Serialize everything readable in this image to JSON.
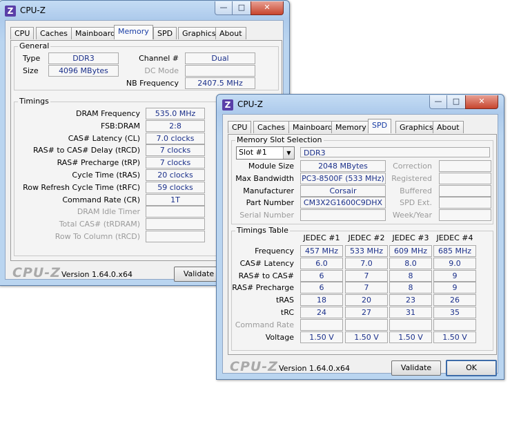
{
  "win1": {
    "title": "CPU-Z",
    "tabs": [
      "CPU",
      "Caches",
      "Mainboard",
      "Memory",
      "SPD",
      "Graphics",
      "About"
    ],
    "active_tab": "Memory",
    "general": {
      "title": "General",
      "type_label": "Type",
      "type_value": "DDR3",
      "size_label": "Size",
      "size_value": "4096 MBytes",
      "channel_label": "Channel #",
      "channel_value": "Dual",
      "dc_mode_label": "DC Mode",
      "dc_mode_value": "",
      "nb_freq_label": "NB Frequency",
      "nb_freq_value": "2407.5 MHz"
    },
    "timings": {
      "title": "Timings",
      "rows": [
        {
          "label": "DRAM Frequency",
          "value": "535.0 MHz",
          "disabled": false
        },
        {
          "label": "FSB:DRAM",
          "value": "2:8",
          "disabled": false
        },
        {
          "label": "CAS# Latency (CL)",
          "value": "7.0 clocks",
          "disabled": false
        },
        {
          "label": "RAS# to CAS# Delay (tRCD)",
          "value": "7 clocks",
          "disabled": false
        },
        {
          "label": "RAS# Precharge (tRP)",
          "value": "7 clocks",
          "disabled": false
        },
        {
          "label": "Cycle Time (tRAS)",
          "value": "20 clocks",
          "disabled": false
        },
        {
          "label": "Row Refresh Cycle Time (tRFC)",
          "value": "59 clocks",
          "disabled": false
        },
        {
          "label": "Command Rate (CR)",
          "value": "1T",
          "disabled": false
        },
        {
          "label": "DRAM Idle Timer",
          "value": "",
          "disabled": true
        },
        {
          "label": "Total CAS# (tRDRAM)",
          "value": "",
          "disabled": true
        },
        {
          "label": "Row To Column (tRCD)",
          "value": "",
          "disabled": true
        }
      ]
    },
    "logo": "CPU-Z",
    "version": "Version 1.64.0.x64",
    "validate_label": "Validate"
  },
  "win2": {
    "title": "CPU-Z",
    "tabs": [
      "CPU",
      "Caches",
      "Mainboard",
      "Memory",
      "SPD",
      "Graphics",
      "About"
    ],
    "active_tab": "SPD",
    "slot": {
      "title": "Memory Slot Selection",
      "selected": "Slot #1",
      "type_value": "DDR3",
      "left_rows": [
        {
          "label": "Module Size",
          "value": "2048 MBytes"
        },
        {
          "label": "Max Bandwidth",
          "value": "PC3-8500F (533 MHz)"
        },
        {
          "label": "Manufacturer",
          "value": "Corsair"
        },
        {
          "label": "Part Number",
          "value": "CM3X2G1600C9DHX"
        },
        {
          "label": "Serial Number",
          "value": ""
        }
      ],
      "right_rows": [
        {
          "label": "Correction",
          "value": ""
        },
        {
          "label": "Registered",
          "value": ""
        },
        {
          "label": "Buffered",
          "value": ""
        },
        {
          "label": "SPD Ext.",
          "value": ""
        },
        {
          "label": "Week/Year",
          "value": ""
        }
      ]
    },
    "timings_table": {
      "title": "Timings Table",
      "columns": [
        "JEDEC #1",
        "JEDEC #2",
        "JEDEC #3",
        "JEDEC #4"
      ],
      "rows": [
        {
          "label": "Frequency",
          "values": [
            "457 MHz",
            "533 MHz",
            "609 MHz",
            "685 MHz"
          ],
          "disabled": false
        },
        {
          "label": "CAS# Latency",
          "values": [
            "6.0",
            "7.0",
            "8.0",
            "9.0"
          ],
          "disabled": false
        },
        {
          "label": "RAS# to CAS#",
          "values": [
            "6",
            "7",
            "8",
            "9"
          ],
          "disabled": false
        },
        {
          "label": "RAS# Precharge",
          "values": [
            "6",
            "7",
            "8",
            "9"
          ],
          "disabled": false
        },
        {
          "label": "tRAS",
          "values": [
            "18",
            "20",
            "23",
            "26"
          ],
          "disabled": false
        },
        {
          "label": "tRC",
          "values": [
            "24",
            "27",
            "31",
            "35"
          ],
          "disabled": false
        },
        {
          "label": "Command Rate",
          "values": [
            "",
            "",
            "",
            ""
          ],
          "disabled": true
        },
        {
          "label": "Voltage",
          "values": [
            "1.50 V",
            "1.50 V",
            "1.50 V",
            "1.50 V"
          ],
          "disabled": false
        }
      ]
    },
    "logo": "CPU-Z",
    "version": "Version 1.64.0.x64",
    "validate_label": "Validate",
    "ok_label": "OK"
  }
}
